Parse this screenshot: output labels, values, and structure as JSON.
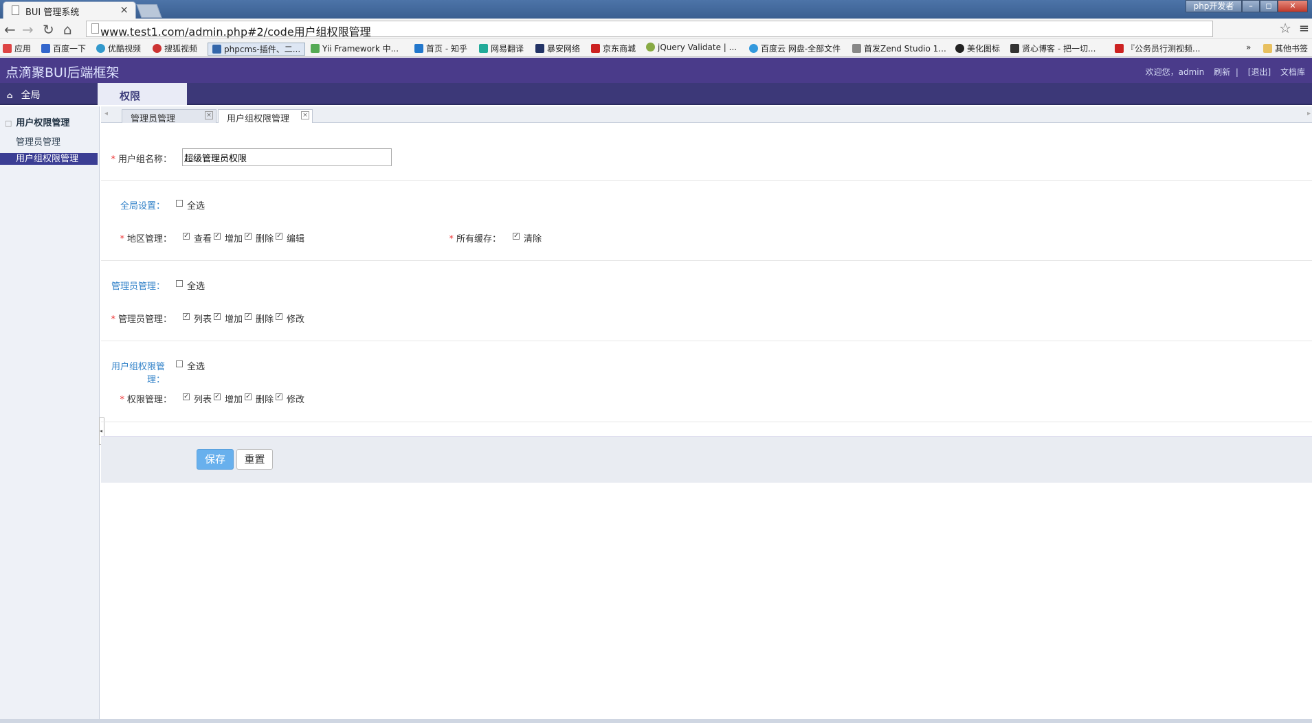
{
  "browser": {
    "tab_title": "BUI 管理系统",
    "tab_close": "×",
    "window_badge": "php开发者",
    "url": "www.test1.com/admin.php#2/code用户组权限管理",
    "bookmarks": [
      "应用",
      "百度一下",
      "优酷视频",
      "搜狐视频",
      "phpcms-插件、二...",
      "Yii Framework 中...",
      "首页 - 知乎",
      "网易翻译",
      "暴安网络",
      "京东商城",
      "jQuery Validate | ...",
      "百度云 网盘-全部文件",
      "首发Zend Studio 1...",
      "美化图标",
      "贤心博客 - 把一切...",
      "『公务员行测视频...",
      "»",
      "其他书签"
    ],
    "accent": "#4a3b8a"
  },
  "header": {
    "logo": "点滴聚BUI后端框架",
    "welcome": "欢迎您，admin",
    "refresh": "刷新",
    "sep": "|",
    "logout": "[退出]",
    "docs": "文档库"
  },
  "menu": {
    "home": "全局",
    "active_tab": "权限"
  },
  "sidebar": {
    "title": "用户权限管理",
    "toggle": "□",
    "items": [
      "管理员管理",
      "用户组权限管理"
    ]
  },
  "tabs": [
    "管理员管理",
    "用户组权限管理"
  ],
  "form": {
    "group_name_label": "用户组名称：",
    "group_name_value": "超级管理员权限",
    "sections": [
      {
        "header": "全局设置：",
        "select_all": "全选",
        "rows": [
          {
            "label": "地区管理：",
            "options": [
              "查看",
              "增加",
              "删除",
              "编辑"
            ]
          },
          {
            "label": "所有缓存：",
            "options": [
              "清除"
            ]
          }
        ]
      },
      {
        "header": "管理员管理：",
        "select_all": "全选",
        "rows": [
          {
            "label": "管理员管理：",
            "options": [
              "列表",
              "增加",
              "删除",
              "修改"
            ]
          }
        ]
      },
      {
        "header": "用户组权限管理：",
        "select_all": "全选",
        "rows": [
          {
            "label": "权限管理：",
            "options": [
              "列表",
              "增加",
              "删除",
              "修改"
            ]
          }
        ]
      }
    ],
    "save": "保存",
    "reset": "重置"
  }
}
